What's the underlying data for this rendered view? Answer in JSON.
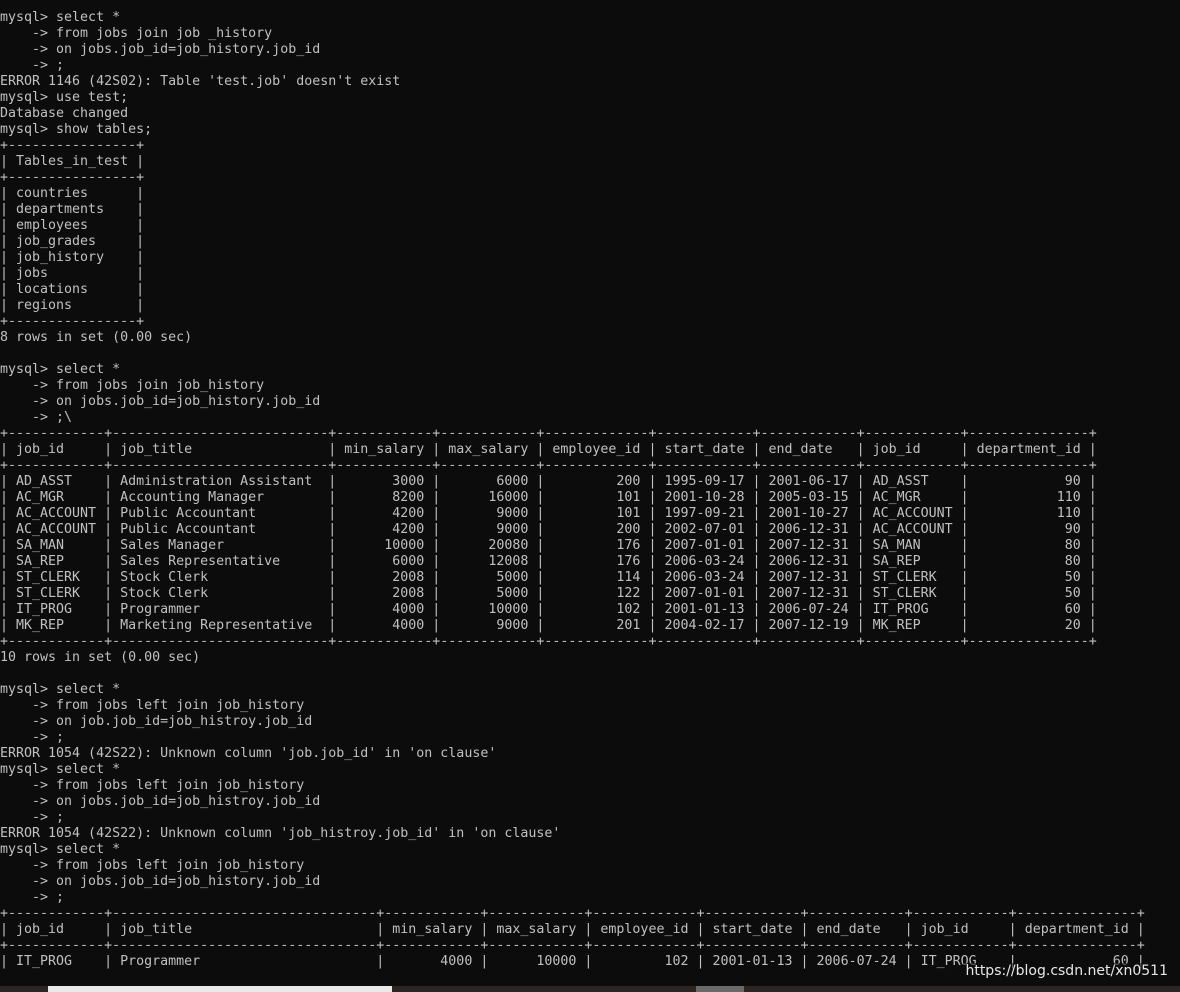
{
  "terminal": {
    "lines": [
      "mysql> select *",
      "    -> from jobs join job _history",
      "    -> on jobs.job_id=job_history.job_id",
      "    -> ;",
      "ERROR 1146 (42S02): Table 'test.job' doesn't exist",
      "mysql> use test;",
      "Database changed",
      "mysql> show tables;",
      "+----------------+",
      "| Tables_in_test |",
      "+----------------+",
      "| countries      |",
      "| departments    |",
      "| employees      |",
      "| job_grades     |",
      "| job_history    |",
      "| jobs           |",
      "| locations      |",
      "| regions        |",
      "+----------------+",
      "8 rows in set (0.00 sec)",
      "",
      "mysql> select *",
      "    -> from jobs join job_history",
      "    -> on jobs.job_id=job_history.job_id",
      "    -> ;\\",
      "+------------+---------------------------+------------+------------+-------------+------------+------------+------------+---------------+",
      "| job_id     | job_title                 | min_salary | max_salary | employee_id | start_date | end_date   | job_id     | department_id |",
      "+------------+---------------------------+------------+------------+-------------+------------+------------+------------+---------------+",
      "| AD_ASST    | Administration Assistant  |       3000 |       6000 |         200 | 1995-09-17 | 2001-06-17 | AD_ASST    |            90 |",
      "| AC_MGR     | Accounting Manager        |       8200 |      16000 |         101 | 2001-10-28 | 2005-03-15 | AC_MGR     |           110 |",
      "| AC_ACCOUNT | Public Accountant         |       4200 |       9000 |         101 | 1997-09-21 | 2001-10-27 | AC_ACCOUNT |           110 |",
      "| AC_ACCOUNT | Public Accountant         |       4200 |       9000 |         200 | 2002-07-01 | 2006-12-31 | AC_ACCOUNT |            90 |",
      "| SA_MAN     | Sales Manager             |      10000 |      20080 |         176 | 2007-01-01 | 2007-12-31 | SA_MAN     |            80 |",
      "| SA_REP     | Sales Representative      |       6000 |      12008 |         176 | 2006-03-24 | 2006-12-31 | SA_REP     |            80 |",
      "| ST_CLERK   | Stock Clerk               |       2008 |       5000 |         114 | 2006-03-24 | 2007-12-31 | ST_CLERK   |            50 |",
      "| ST_CLERK   | Stock Clerk               |       2008 |       5000 |         122 | 2007-01-01 | 2007-12-31 | ST_CLERK   |            50 |",
      "| IT_PROG    | Programmer                |       4000 |      10000 |         102 | 2001-01-13 | 2006-07-24 | IT_PROG    |            60 |",
      "| MK_REP     | Marketing Representative  |       4000 |       9000 |         201 | 2004-02-17 | 2007-12-19 | MK_REP     |            20 |",
      "+------------+---------------------------+------------+------------+-------------+------------+------------+------------+---------------+",
      "10 rows in set (0.00 sec)",
      "",
      "mysql> select *",
      "    -> from jobs left join job_history",
      "    -> on job.job_id=job_histroy.job_id",
      "    -> ;",
      "ERROR 1054 (42S22): Unknown column 'job.job_id' in 'on clause'",
      "mysql> select *",
      "    -> from jobs left join job_history",
      "    -> on jobs.job_id=job_histroy.job_id",
      "    -> ;",
      "ERROR 1054 (42S22): Unknown column 'job_histroy.job_id' in 'on clause'",
      "mysql> select *",
      "    -> from jobs left join job_history",
      "    -> on jobs.job_id=job_history.job_id",
      "    -> ;",
      "+------------+---------------------------------+------------+------------+-------------+------------+------------+------------+---------------+",
      "| job_id     | job_title                       | min_salary | max_salary | employee_id | start_date | end_date   | job_id     | department_id |",
      "+------------+---------------------------------+------------+------------+-------------+------------+------------+------------+---------------+",
      "| IT_PROG    | Programmer                      |       4000 |      10000 |         102 | 2001-01-13 | 2006-07-24 | IT_PROG    |            60 |"
    ]
  },
  "watermark": "https://blog.csdn.net/xn0511",
  "colors": {
    "background": "#0c0c0c",
    "text": "#c0c0c0"
  }
}
